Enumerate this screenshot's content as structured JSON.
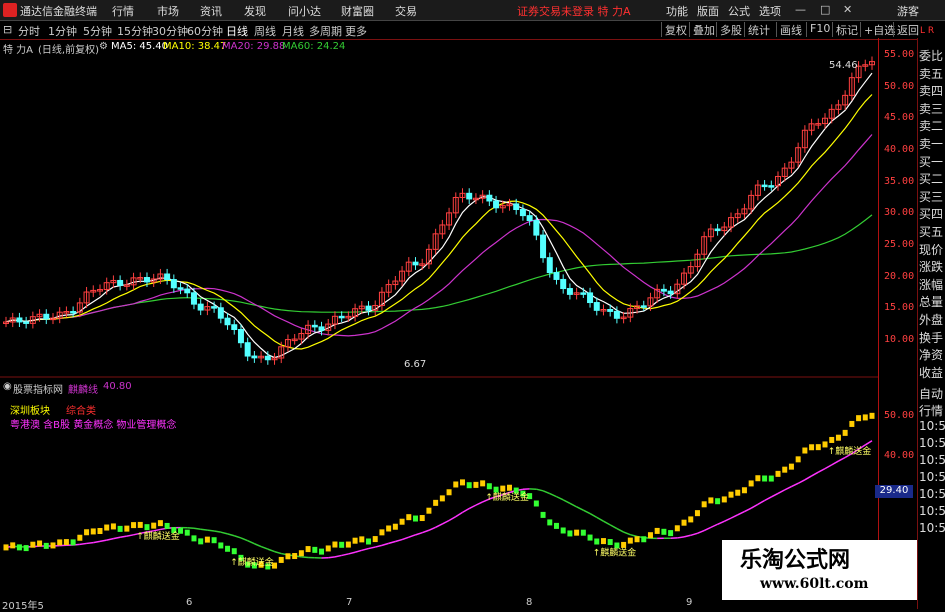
{
  "app": {
    "name": "通达信金融终端"
  },
  "menu": [
    {
      "label": "行情"
    },
    {
      "label": "市场"
    },
    {
      "label": "资讯"
    },
    {
      "label": "发现"
    },
    {
      "label": "问小达"
    },
    {
      "label": "财富圈"
    },
    {
      "label": "交易"
    }
  ],
  "status_text": "证券交易未登录  特 力A",
  "top_right": [
    {
      "label": "功能"
    },
    {
      "label": "版面"
    },
    {
      "label": "公式"
    },
    {
      "label": "选项"
    }
  ],
  "guest_label": "游客",
  "periods": [
    {
      "label": "分时"
    },
    {
      "label": "1分钟"
    },
    {
      "label": "5分钟"
    },
    {
      "label": "15分钟"
    },
    {
      "label": "30分钟"
    },
    {
      "label": "60分钟"
    },
    {
      "label": "日线"
    },
    {
      "label": "周线"
    },
    {
      "label": "月线"
    },
    {
      "label": "多周期"
    },
    {
      "label": "更多"
    }
  ],
  "toolbar_right": [
    {
      "label": "复权"
    },
    {
      "label": "叠加"
    },
    {
      "label": "多股"
    },
    {
      "label": "统计"
    },
    {
      "label": "画线"
    },
    {
      "label": "F10"
    },
    {
      "label": "标记"
    },
    {
      "label": "+自选"
    },
    {
      "label": "返回"
    }
  ],
  "main_chart": {
    "stock_label": "特 力A",
    "adjust_label": "(日线,前复权)",
    "ma5": "MA5: 45.40",
    "ma10": "MA10: 38.47",
    "ma20": "MA20: 29.88",
    "ma60": "MA60: 24.24",
    "ma5_color": "#ffffff",
    "ma10_color": "#ffff00",
    "ma20_color": "#cc33cc",
    "ma60_color": "#33cc33",
    "high_label": "54.46",
    "low_label": "6.67",
    "y_ticks": [
      "55.00",
      "50.00",
      "45.00",
      "40.00",
      "35.00",
      "30.00",
      "25.00",
      "20.00",
      "15.00",
      "10.00"
    ]
  },
  "sub_chart": {
    "name": "股票指标网",
    "indicator": "麒麟线",
    "value": "40.80",
    "block_label": "深圳板块",
    "block_value": "综合类",
    "concepts": "粤港澳 含B股 黄金概念 物业管理概念",
    "signal_label": "麒麟送金",
    "y_ticks": [
      "50.00",
      "40.00"
    ],
    "current_tag": "29.40"
  },
  "x_labels": [
    "2015年5",
    "6",
    "7",
    "8",
    "9"
  ],
  "side_panel": [
    "委比",
    "卖五",
    "卖四",
    "卖三",
    "卖二",
    "卖一",
    "买一",
    "买二",
    "买三",
    "买四",
    "买五",
    "现价",
    "涨跌",
    "涨幅",
    "总量",
    "外盘",
    "换手",
    "净资",
    "收益"
  ],
  "side_panel_lower": [
    "自动",
    "行情",
    "10:5",
    "10:5",
    "10:5",
    "10:5",
    "10:5",
    "10:5",
    "10:5"
  ],
  "watermark": {
    "line1": "乐淘公式网",
    "line2": "www.60lt.com"
  },
  "chart_data": {
    "type": "candlestick",
    "x": [
      "2015-05",
      "2015-06",
      "2015-07",
      "2015-08",
      "2015-09"
    ],
    "price_axis": [
      10,
      55
    ],
    "close_path_keypoints": [
      13,
      14,
      19,
      20,
      15,
      7,
      12,
      15,
      22,
      33,
      31,
      18,
      14,
      18,
      28,
      35,
      45,
      54.46
    ],
    "high": 54.46,
    "low": 6.67
  }
}
